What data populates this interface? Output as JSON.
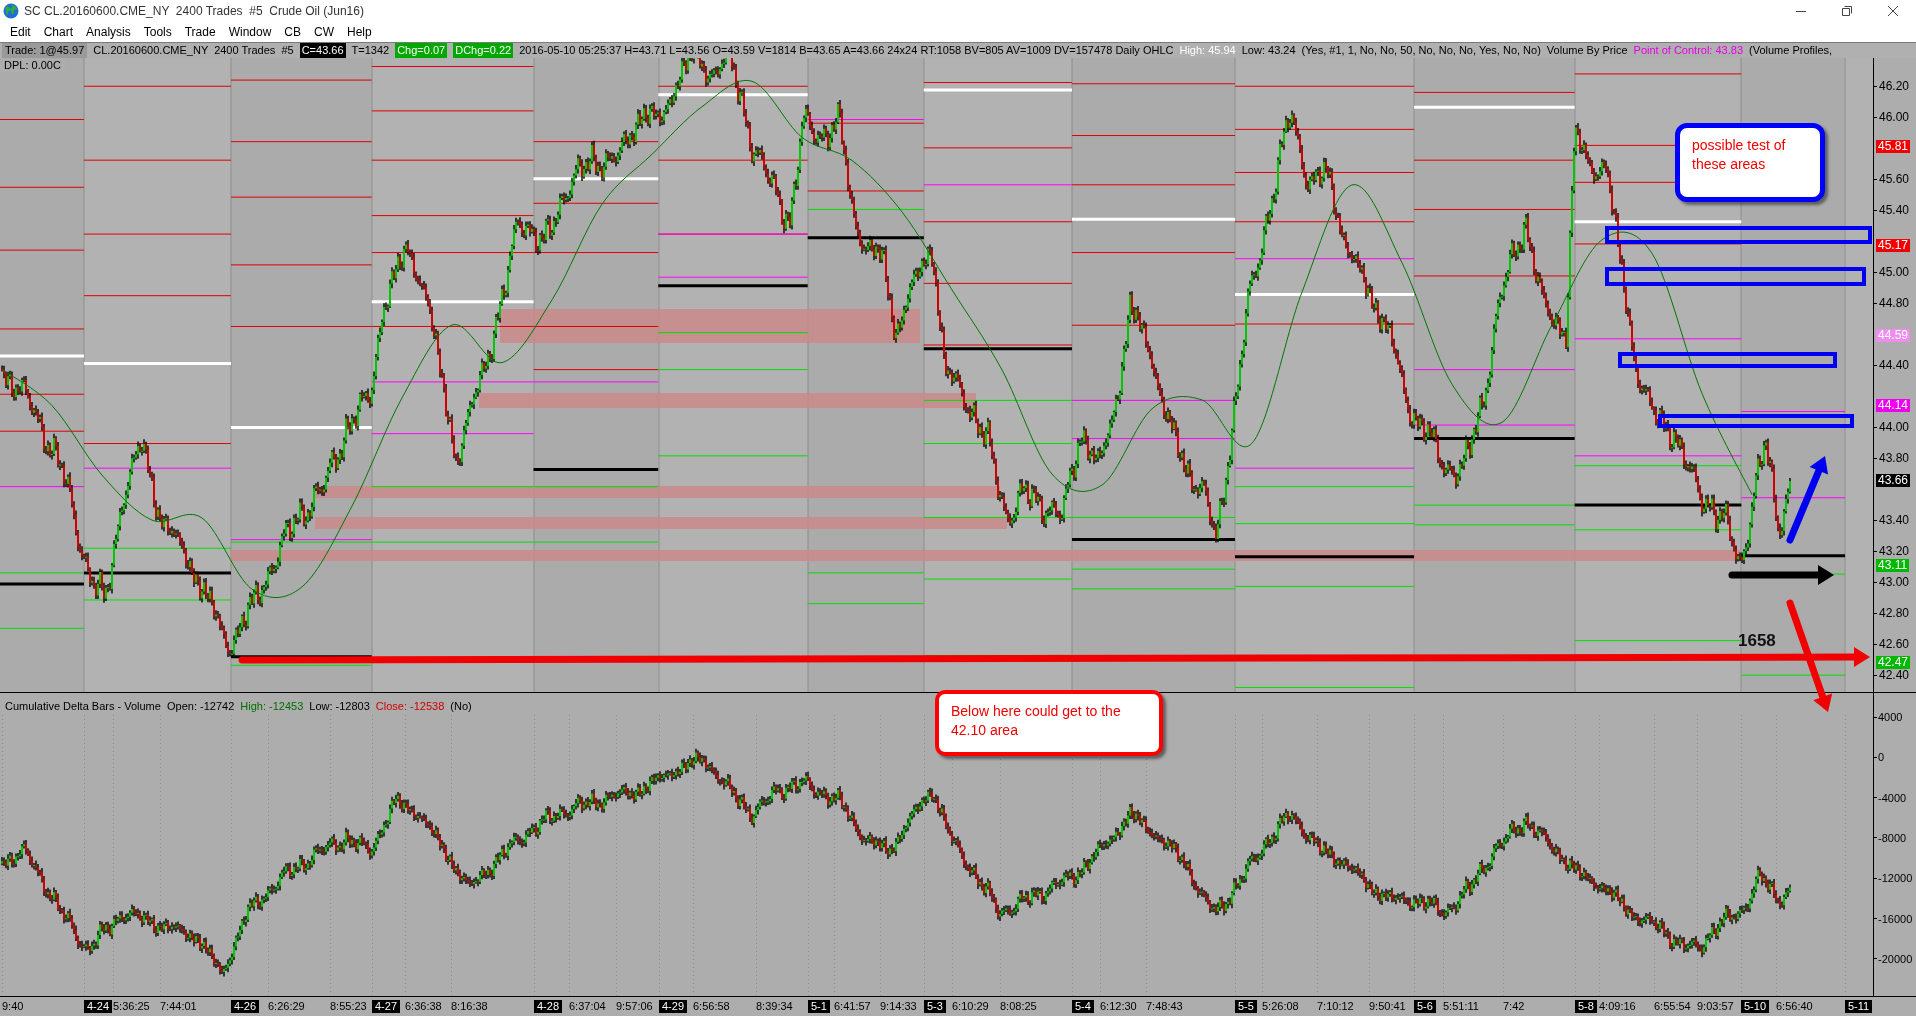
{
  "window": {
    "title": "SC CL.20160600.CME_NY  2400 Trades  #5  Crude Oil (Jun16)"
  },
  "menu": [
    "Edit",
    "Chart",
    "Analysis",
    "Tools",
    "Trade",
    "Window",
    "CB",
    "CW",
    "Help"
  ],
  "info_bar": [
    {
      "text": "Trade: 1@45.97",
      "kind": "boxed"
    },
    {
      "text": "CL.20160600.CME_NY  2400 Trades  #5",
      "kind": "plain"
    },
    {
      "text": "C=43.66",
      "kind": "inverse"
    },
    {
      "text": "T=1342",
      "kind": "plain"
    },
    {
      "text": "Chg=0.07",
      "kind": "green"
    },
    {
      "text": "DChg=0.22",
      "kind": "green"
    },
    {
      "text": "2016-05-10 05:25:37 H=43.71 L=43.56 O=43.59 V=1814 B=43.65 A=43.66 24x24 RT:1058 BV=805 AV=1009 DV=157478 Daily OHLC",
      "kind": "plain"
    },
    {
      "text": "High: 45.94",
      "kind": "white"
    },
    {
      "text": "Low: 43.24",
      "kind": "plain"
    },
    {
      "text": "(Yes, #1, 1, No, No, 50, No, No, No, Yes, No, No)",
      "kind": "plain"
    },
    {
      "text": "Volume By Price",
      "kind": "plain"
    },
    {
      "text": "Point of Control: 43.83",
      "kind": "magenta"
    },
    {
      "text": "(Volume Profiles,",
      "kind": "plain"
    }
  ],
  "price_panel": {
    "dpl": "DPL: 0.00C",
    "label": "1658",
    "axis_ticks": [
      "46.20",
      "46.00",
      "45.60",
      "45.40",
      "45.00",
      "44.80",
      "44.40",
      "44.00",
      "43.80",
      "43.40",
      "43.20",
      "43.00",
      "42.80",
      "42.60",
      "42.40"
    ],
    "axis_markers": [
      {
        "text": "45.81",
        "color": "#f00000"
      },
      {
        "text": "45.17",
        "color": "#f00000"
      },
      {
        "text": "44.59",
        "color": "#f08cf0"
      },
      {
        "text": "44.14",
        "color": "#f000f0"
      },
      {
        "text": "43.66",
        "color": "#000000"
      },
      {
        "text": "43.11",
        "color": "#00b800"
      },
      {
        "text": "42.47",
        "color": "#00b800"
      }
    ]
  },
  "annotations": [
    {
      "text": "possible test of these areas",
      "color": "#0000ff"
    },
    {
      "text": "Below here could get to the 42.10 area",
      "color": "#ff0000"
    }
  ],
  "lower_panel": {
    "header": [
      {
        "text": "Cumulative Delta Bars - Volume  Open: -12742",
        "kind": "plain"
      },
      {
        "text": "High: -12453",
        "kind": "green"
      },
      {
        "text": "Low: -12803",
        "kind": "plain"
      },
      {
        "text": "Close: -12538",
        "kind": "red"
      },
      {
        "text": "(No)",
        "kind": "plain"
      }
    ],
    "axis_ticks": [
      "4000",
      "0",
      "-4000",
      "-8000",
      "-12000",
      "-16000",
      "-20000"
    ]
  },
  "time_axis": [
    {
      "text": "9:40",
      "kind": "time"
    },
    {
      "text": "4-24",
      "kind": "date"
    },
    {
      "text": "5:36:25",
      "kind": "time"
    },
    {
      "text": "7:44:01",
      "kind": "time"
    },
    {
      "text": "4-26",
      "kind": "date"
    },
    {
      "text": "6:26:29",
      "kind": "time"
    },
    {
      "text": "8:55:23",
      "kind": "time"
    },
    {
      "text": "4-27",
      "kind": "date"
    },
    {
      "text": "6:36:38",
      "kind": "time"
    },
    {
      "text": "8:16:38",
      "kind": "time"
    },
    {
      "text": "4-28",
      "kind": "date"
    },
    {
      "text": "6:37:04",
      "kind": "time"
    },
    {
      "text": "9:57:06",
      "kind": "time"
    },
    {
      "text": "4-29",
      "kind": "date"
    },
    {
      "text": "6:56:58",
      "kind": "time"
    },
    {
      "text": "8:39:34",
      "kind": "time"
    },
    {
      "text": "5-1",
      "kind": "date"
    },
    {
      "text": "6:41:57",
      "kind": "time"
    },
    {
      "text": "9:14:33",
      "kind": "time"
    },
    {
      "text": "5-3",
      "kind": "date"
    },
    {
      "text": "6:10:29",
      "kind": "time"
    },
    {
      "text": "8:08:25",
      "kind": "time"
    },
    {
      "text": "5-4",
      "kind": "date"
    },
    {
      "text": "6:12:30",
      "kind": "time"
    },
    {
      "text": "7:48:43",
      "kind": "time"
    },
    {
      "text": "5-5",
      "kind": "date"
    },
    {
      "text": "5:26:08",
      "kind": "time"
    },
    {
      "text": "7:10:12",
      "kind": "time"
    },
    {
      "text": "9:50:41",
      "kind": "time"
    },
    {
      "text": "5-6",
      "kind": "date"
    },
    {
      "text": "5:51:11",
      "kind": "time"
    },
    {
      "text": "7:42",
      "kind": "time"
    },
    {
      "text": "5-8",
      "kind": "date"
    },
    {
      "text": "4:09:16",
      "kind": "time"
    },
    {
      "text": "6:55:54",
      "kind": "time"
    },
    {
      "text": "9:03:57",
      "kind": "time"
    },
    {
      "text": "5-10",
      "kind": "date"
    },
    {
      "text": "6:56:40",
      "kind": "time"
    },
    {
      "text": "5-11",
      "kind": "date"
    }
  ]
}
